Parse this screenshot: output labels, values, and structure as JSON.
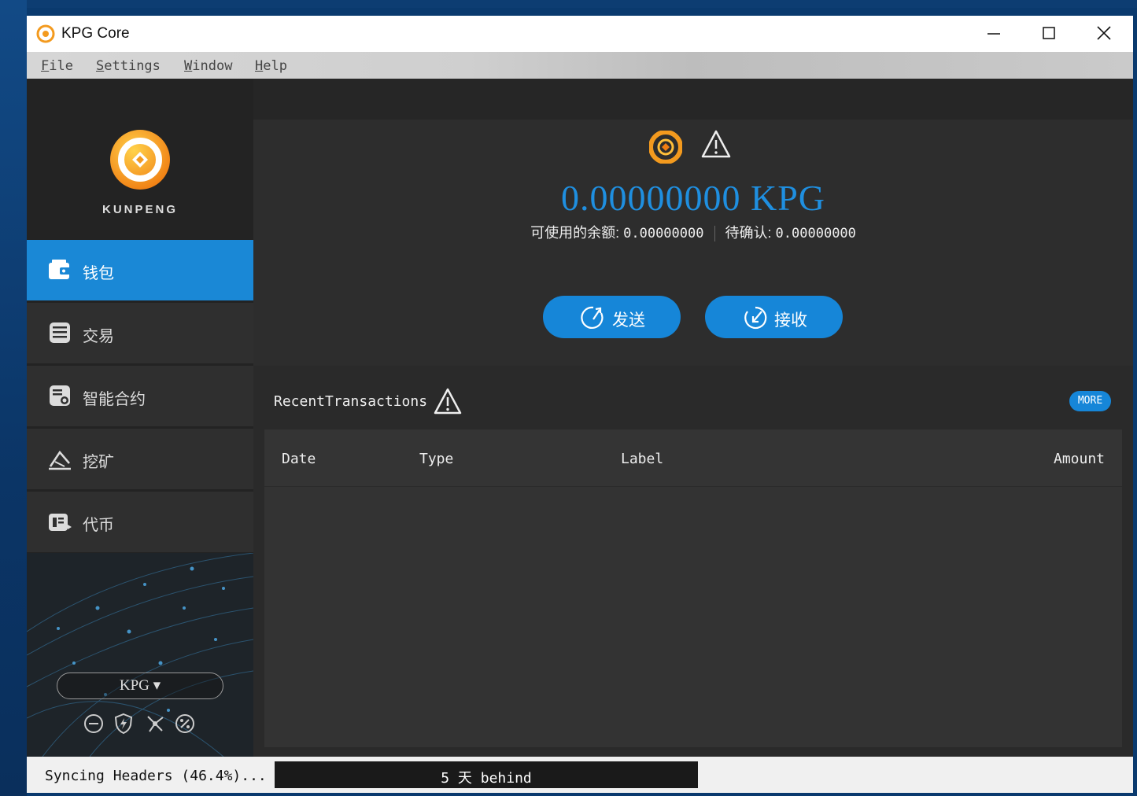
{
  "window": {
    "title": "KPG Core"
  },
  "menu": [
    {
      "label": "File",
      "mnemonic": "F",
      "rest": "ile"
    },
    {
      "label": "Settings",
      "mnemonic": "S",
      "rest": "ettings"
    },
    {
      "label": "Window",
      "mnemonic": "W",
      "rest": "indow"
    },
    {
      "label": "Help",
      "mnemonic": "H",
      "rest": "elp"
    }
  ],
  "sidebar": {
    "brand": "KUNPENG",
    "items": [
      {
        "label": "钱包",
        "icon": "wallet-icon",
        "active": true
      },
      {
        "label": "交易",
        "icon": "transactions-icon",
        "active": false
      },
      {
        "label": "智能合约",
        "icon": "smart-contract-icon",
        "active": false
      },
      {
        "label": "挖矿",
        "icon": "mining-icon",
        "active": false
      },
      {
        "label": "代币",
        "icon": "token-icon",
        "active": false
      }
    ],
    "currency_select": "KPG ▾",
    "status_icons": [
      "minus-circle-icon",
      "shield-lightning-icon",
      "network-icon",
      "percent-circle-icon"
    ]
  },
  "balance": {
    "total": "0.00000000 KPG",
    "available_label": "可使用的余额:",
    "available_value": "0.00000000",
    "pending_label": "待确认:",
    "pending_value": "0.00000000"
  },
  "actions": {
    "send": "发送",
    "receive": "接收"
  },
  "recent": {
    "title": "RecentTransactions",
    "more": "MORE",
    "columns": [
      "Date",
      "Type",
      "Label",
      "Amount"
    ],
    "rows": []
  },
  "status": {
    "sync_text": "Syncing Headers (46.4%)...",
    "behind": "5 天 behind"
  },
  "colors": {
    "accent": "#1686d8",
    "balance": "#1f8fe0",
    "logo_orange": "#f39a1e"
  }
}
